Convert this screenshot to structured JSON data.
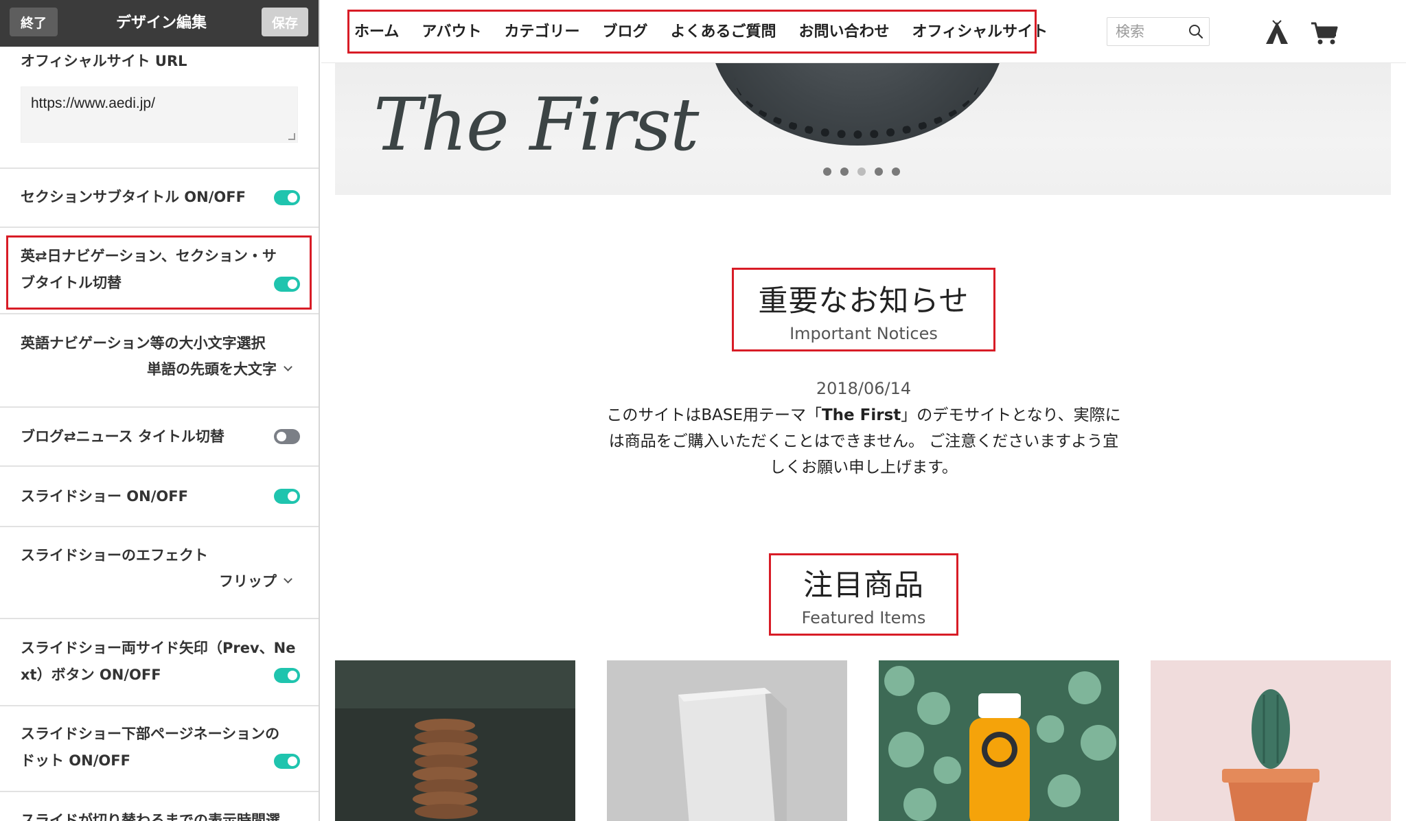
{
  "editor": {
    "exit_label": "終了",
    "title": "デザイン編集",
    "save_label": "保存",
    "url_label": "オフィシャルサイト URL",
    "url_value": "https://www.aedi.jp/",
    "settings": [
      {
        "label": "セクションサブタイトル ON/OFF",
        "toggle": "on"
      },
      {
        "label_line1": "英⇄日ナビゲーション、セクション・サ",
        "label_line2": "ブタイトル切替",
        "toggle": "on"
      },
      {
        "label": "英語ナビゲーション等の大小文字選択",
        "select": "単語の先頭を大文字"
      },
      {
        "label": "ブログ⇄ニュース タイトル切替",
        "toggle": "off"
      },
      {
        "label": "スライドショー ON/OFF",
        "toggle": "on"
      },
      {
        "label": "スライドショーのエフェクト",
        "select": "フリップ"
      },
      {
        "label_line1": "スライドショー両サイド矢印（Prev、Ne",
        "label_line2": "xt）ボタン ON/OFF",
        "toggle": "on"
      },
      {
        "label_line1": "スライドショー下部ページネーションの",
        "label_line2": "ドット ON/OFF",
        "toggle": "on"
      },
      {
        "label": "スライドが切り替わるまでの表示時間選"
      }
    ]
  },
  "site": {
    "nav": [
      "ホーム",
      "アバウト",
      "カテゴリー",
      "ブログ",
      "よくあるご質問",
      "お問い合わせ",
      "オフィシャルサイト"
    ],
    "search_placeholder": "検索",
    "hero_logo": "The First",
    "hero_dots": 5,
    "hero_active_dot": 3,
    "notices": {
      "title_jp": "重要なお知らせ",
      "title_en": "Important Notices",
      "date": "2018/06/14",
      "body_part1": "このサイトはBASE用テーマ「",
      "body_bold": "The First",
      "body_part2": "」のデモサイトとなり、実際には商品をご購入いただくことはできません。 ご注意くださいますよう宜しくお願い申し上げます。"
    },
    "featured": {
      "title_jp": "注目商品",
      "title_en": "Featured Items"
    },
    "products": [
      "cookies",
      "book",
      "juice",
      "cactus"
    ]
  },
  "colors": {
    "accent_toggle": "#1fc4ae",
    "highlight_box": "#d81c26",
    "editor_header": "#3b3b3b"
  }
}
